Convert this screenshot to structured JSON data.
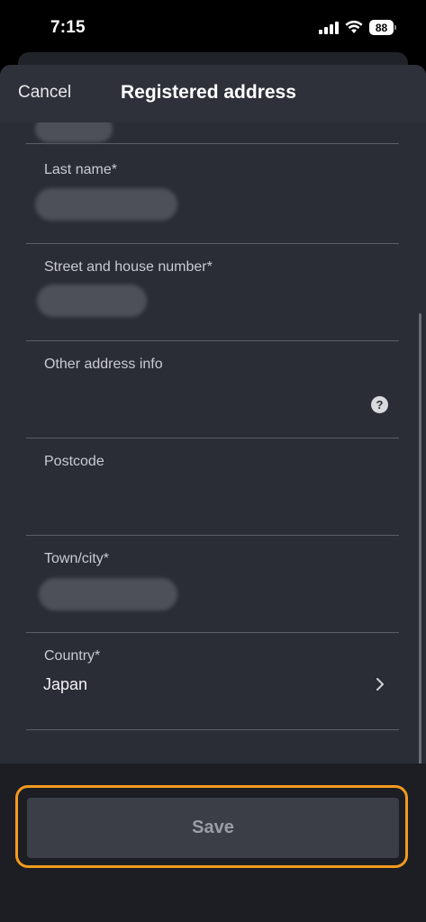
{
  "status_bar": {
    "time": "7:15",
    "battery": "88"
  },
  "nav": {
    "cancel_label": "Cancel",
    "title": "Registered address"
  },
  "form": {
    "fields": [
      {
        "label": "Last name*",
        "value": "",
        "redacted": true
      },
      {
        "label": "Street and house number*",
        "value": "",
        "redacted": true
      },
      {
        "label": "Other address info",
        "value": "",
        "redacted": false,
        "icon": "help-icon"
      },
      {
        "label": "Postcode",
        "value": "",
        "redacted": false
      },
      {
        "label": "Town/city*",
        "value": "",
        "redacted": true
      },
      {
        "label": "Country*",
        "value": "Japan",
        "redacted": false,
        "icon": "chevron-right-icon"
      }
    ]
  },
  "footer": {
    "save_label": "Save",
    "highlight_color": "#f39a1e"
  },
  "colors": {
    "sheet_bg": "#2a2d36",
    "nav_bg": "#2e313a",
    "footer_bg": "#1c1e24",
    "save_bg": "#3b3e47"
  }
}
